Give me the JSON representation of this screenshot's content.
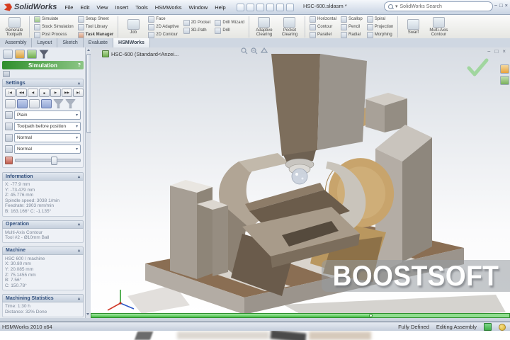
{
  "window": {
    "brand": "SolidWorks",
    "title": "HSC-600.sldasm *",
    "search_text": "SolidWorks Search",
    "min": "−",
    "max": "□",
    "close": "×"
  },
  "docwin": {
    "min": "−",
    "restore": "□",
    "close": "×"
  },
  "ui": {
    "chevron_down": "▾",
    "collapse": "▴",
    "help": "?"
  },
  "menubar": {
    "items": [
      "File",
      "Edit",
      "View",
      "Insert",
      "Tools",
      "HSMWorks",
      "Window",
      "Help"
    ]
  },
  "toolbar": {
    "groups": [
      {
        "label": "Generate Toolpath"
      },
      {
        "items": [
          "Simulate",
          "Stock Simulation",
          "Post Process"
        ]
      },
      {
        "items": [
          "Setup Sheet",
          "Tool Library",
          "Task Manager"
        ]
      },
      {
        "label": "Job"
      },
      {
        "items": [
          "Face",
          "2D Adaptive",
          "2D Contour"
        ]
      },
      {
        "items": [
          "2D Pocket",
          "3D-Path"
        ]
      },
      {
        "items": [
          "Drill Wizard",
          "Drill"
        ]
      },
      {
        "label": "Adaptive Clearing"
      },
      {
        "label": "Pocket Clearing"
      },
      {
        "items": [
          "Horizontal",
          "Contour",
          "Parallel"
        ]
      },
      {
        "items": [
          "Scallop",
          "Pencil",
          "Radial"
        ]
      },
      {
        "items": [
          "Spiral",
          "Projection",
          "Morphing"
        ]
      },
      {
        "label": "Swarf"
      },
      {
        "label": "Multi-Axis Contour"
      }
    ]
  },
  "tabs": {
    "items": [
      "Assembly",
      "Layout",
      "Sketch",
      "Evaluate",
      "HSMWorks"
    ],
    "active": "HSMWorks"
  },
  "panel": {
    "title": "Simulation",
    "settings": {
      "label": "Settings",
      "playback": [
        "|◀",
        "◀◀",
        "◀",
        "■",
        "▶",
        "▶▶",
        "▶|"
      ],
      "dropdowns": [
        {
          "value": "Plain"
        },
        {
          "value": "Toolpath before position"
        },
        {
          "value": "Normal"
        },
        {
          "value": "Normal"
        }
      ],
      "speed_pct": 58
    },
    "information": {
      "label": "Information",
      "lines": [
        "X: -77.9 mm",
        "Y: -73.479 mm",
        "Z: 45.776 mm",
        "Spindle speed: 3038 1/min",
        "Feedrate: 1903 mm/min",
        "B: 163.166°  C: -1.135°"
      ]
    },
    "operation": {
      "label": "Operation",
      "lines": [
        "Multi-Axis Contour",
        "Tool #2 - Ø10mm Ball"
      ]
    },
    "machine": {
      "label": "Machine",
      "lines": [
        "HSC 600 / machine",
        "X: 30.80 mm",
        "Y: 20.085 mm",
        "Z: 75.1455 mm",
        "B: 7.56°",
        "C: 150.78°"
      ]
    },
    "stats": {
      "label": "Machining Statistics",
      "lines": [
        "Time: 1:30 h",
        "Distance: 32% Done"
      ]
    }
  },
  "viewport": {
    "tree_item": "HSC-600 (Standard<Anzei...",
    "watermark": "BOOSTSOFT"
  },
  "timeline": {
    "progress_pct": 67
  },
  "statusbar": {
    "left": "HSMWorks 2010 x64",
    "status": "Fully Defined",
    "mode": "Editing Assembly"
  },
  "icons": {
    "search": "magnifier",
    "quick_access": [
      "new",
      "open",
      "save",
      "print",
      "undo",
      "rebuild"
    ],
    "panel_toolbar": [
      "design-tree",
      "display-settings",
      "hsmworks",
      "filter"
    ],
    "heads_up_view": [
      "zoom-fit",
      "zoom-area",
      "rotate-view"
    ],
    "task_pane": [
      "resources",
      "toolbox"
    ],
    "status_right": [
      "sheet-green",
      "help-coin"
    ]
  },
  "colors": {
    "sim_header_green": "#2f8f2c",
    "timeline_green": "#44bc44",
    "watermark_band": "rgba(150,154,161,0.55)",
    "check_green": "#97d492",
    "logo_red": "#d63d20"
  }
}
